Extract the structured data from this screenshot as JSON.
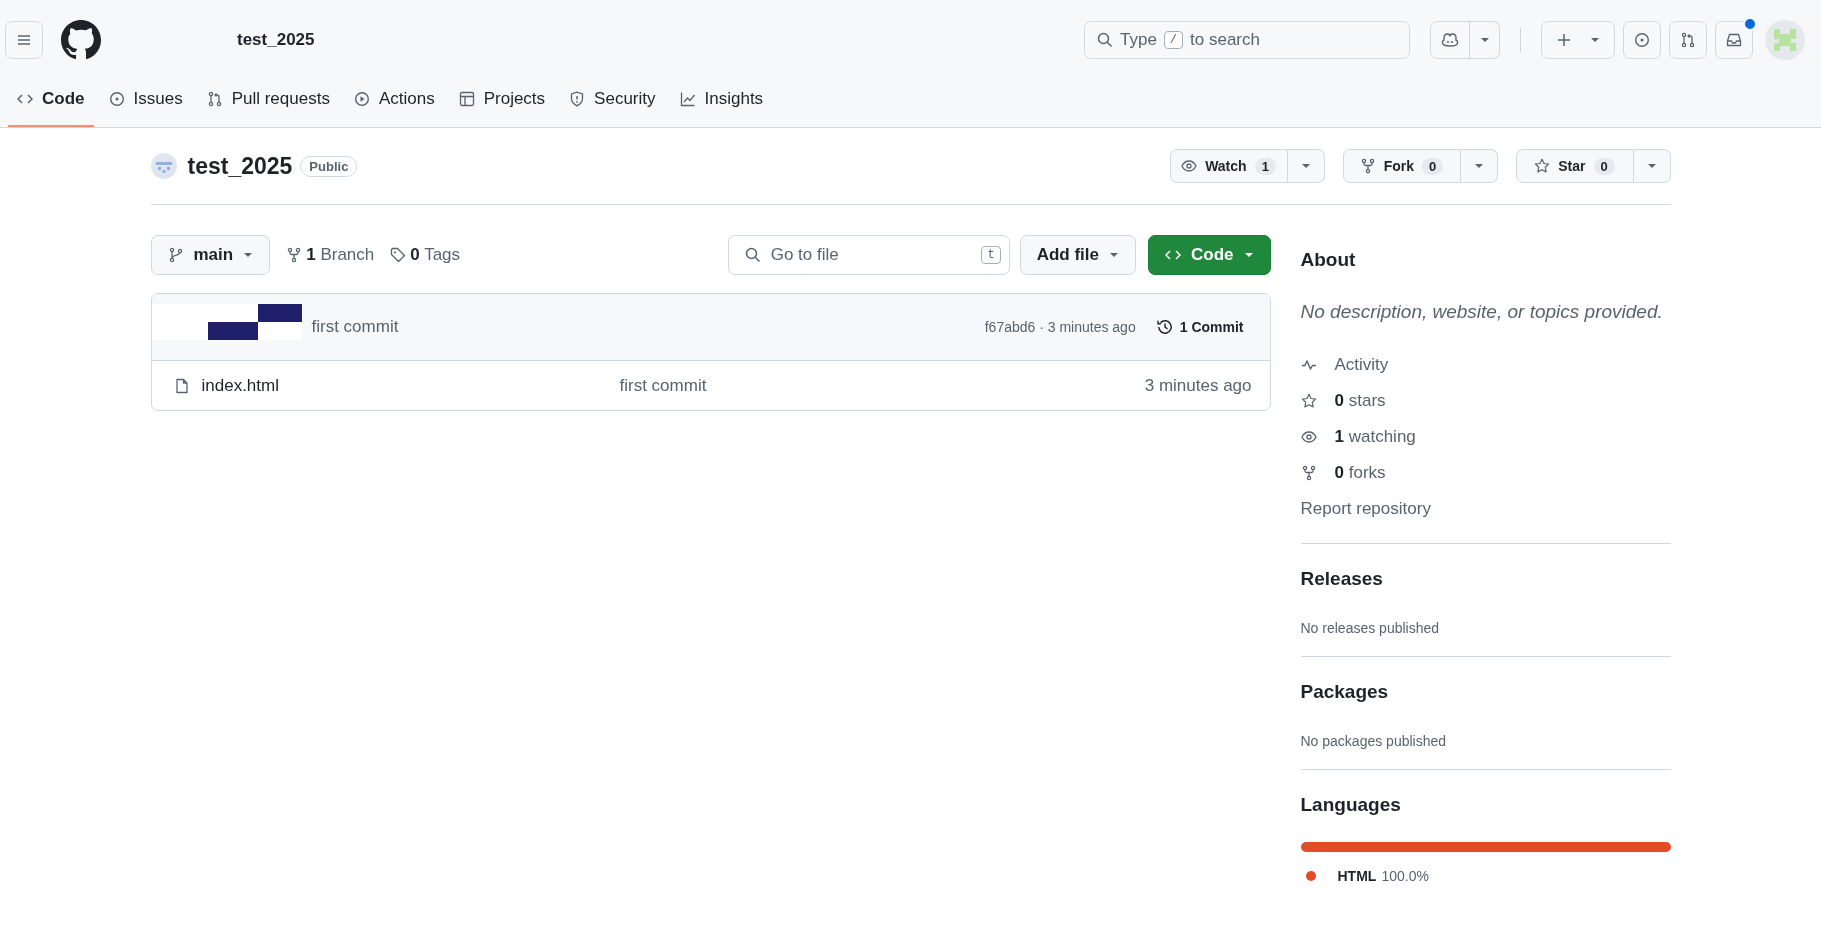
{
  "header": {
    "repo_title": "test_2025",
    "search": {
      "placeholder_before": "Type",
      "key": "/",
      "placeholder_after": "to search"
    },
    "notifications": {
      "unread": true
    }
  },
  "nav_tabs": [
    {
      "label": "Code",
      "selected": true
    },
    {
      "label": "Issues",
      "selected": false
    },
    {
      "label": "Pull requests",
      "selected": false
    },
    {
      "label": "Actions",
      "selected": false
    },
    {
      "label": "Projects",
      "selected": false
    },
    {
      "label": "Security",
      "selected": false
    },
    {
      "label": "Insights",
      "selected": false
    }
  ],
  "repo": {
    "name": "test_2025",
    "visibility": "Public",
    "actions": [
      {
        "label": "Watch",
        "count": "1"
      },
      {
        "label": "Fork",
        "count": "0"
      },
      {
        "label": "Star",
        "count": "0"
      }
    ]
  },
  "toolbar": {
    "branch": "main",
    "branches_count": "1",
    "branches_label": "Branch",
    "tags_count": "0",
    "tags_label": "Tags",
    "go_to_file": {
      "placeholder": "Go to file",
      "key": "t"
    },
    "add_file": "Add file",
    "code": "Code"
  },
  "latest_commit": {
    "message": "first commit",
    "hash_time": "f67abd6 · 3 minutes ago",
    "commits": "1 Commit"
  },
  "files": [
    {
      "name": "index.html",
      "commit": "first commit",
      "time": "3 minutes ago"
    }
  ],
  "about": {
    "title": "About",
    "description": "No description, website, or topics provided.",
    "stats": [
      {
        "label": "Activity"
      },
      {
        "count": "0",
        "label": "stars"
      },
      {
        "count": "1",
        "label": "watching"
      },
      {
        "count": "0",
        "label": "forks"
      }
    ],
    "report": "Report repository"
  },
  "releases": {
    "title": "Releases",
    "note": "No releases published"
  },
  "packages": {
    "title": "Packages",
    "note": "No packages published"
  },
  "languages": {
    "title": "Languages",
    "items": [
      {
        "name": "HTML",
        "percent": "100.0%",
        "level": 1,
        "color": "#e34c26"
      }
    ]
  }
}
